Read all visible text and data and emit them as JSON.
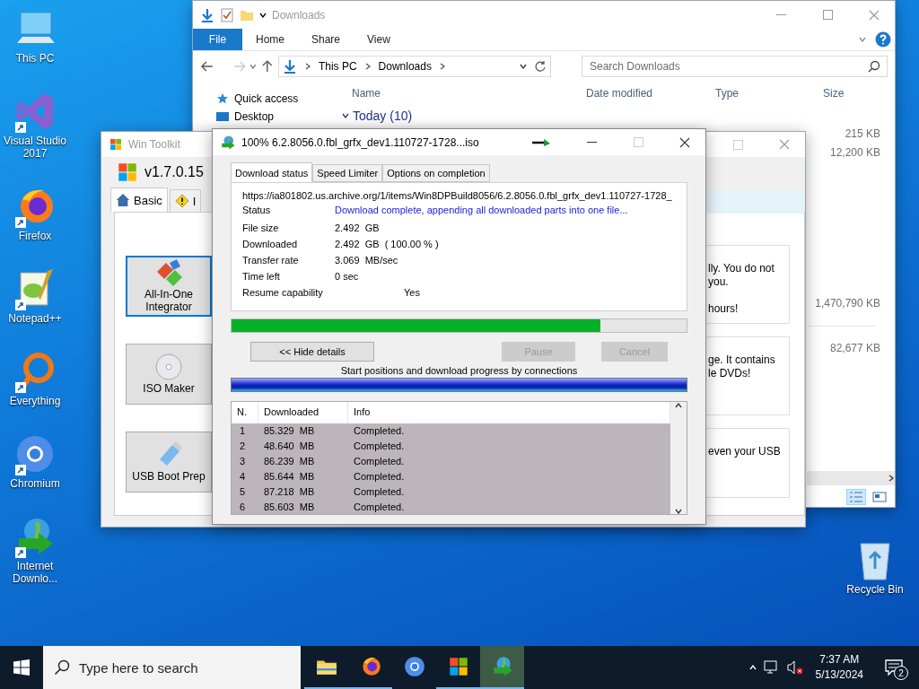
{
  "desktop_icons": [
    {
      "label": "This PC",
      "kind": "pc"
    },
    {
      "label": "Visual Studio 2017",
      "kind": "vs"
    },
    {
      "label": "Firefox",
      "kind": "firefox"
    },
    {
      "label": "Notepad++",
      "kind": "notepad"
    },
    {
      "label": "Everything",
      "kind": "everything"
    },
    {
      "label": "Chromium",
      "kind": "chromium"
    },
    {
      "label": "Internet Downlo...",
      "kind": "idm"
    }
  ],
  "recycle_bin": {
    "label": "Recycle Bin"
  },
  "explorer": {
    "title": "Downloads",
    "ribbon_tabs": [
      {
        "label": "File",
        "selected": true
      },
      {
        "label": "Home",
        "selected": false
      },
      {
        "label": "Share",
        "selected": false
      },
      {
        "label": "View",
        "selected": false
      }
    ],
    "address": [
      "This PC",
      "Downloads"
    ],
    "search": {
      "placeholder": "Search Downloads"
    },
    "nav": [
      "Quick access",
      "Desktop"
    ],
    "columns": [
      "Name",
      "Date modified",
      "Type",
      "Size"
    ],
    "group": "Today (10)",
    "sizes": [
      "215 KB",
      "12,200 KB",
      "1,470,790 KB",
      "82,677 KB"
    ]
  },
  "win_toolkit": {
    "title": "Win Toolkit",
    "version": "v1.7.0.15",
    "tabs": [
      {
        "label": "Basic",
        "selected": true,
        "kind": "home"
      },
      {
        "label": "I",
        "selected": false,
        "kind": "warning"
      }
    ],
    "tools": [
      {
        "label": "All-In-One Integrator",
        "selected": true,
        "kind": "integrator"
      },
      {
        "label": "ISO Maker",
        "selected": false,
        "kind": "disc"
      },
      {
        "label": "USB Boot Prep",
        "selected": false,
        "kind": "usb"
      }
    ],
    "cards": [
      {
        "lines": [
          {
            "text": "lly. You do not"
          },
          {
            "text": "you."
          },
          {
            "text": "hours!"
          }
        ]
      },
      {
        "lines": [
          {
            "text": "ge. It contains"
          },
          {
            "text": "le DVDs!"
          }
        ]
      },
      {
        "lines": [
          {
            "text": "even your USB"
          }
        ]
      }
    ]
  },
  "download_dialog": {
    "title": "100% 6.2.8056.0.fbl_grfx_dev1.110727-1728...iso",
    "tabs": [
      {
        "label": "Download status",
        "selected": true
      },
      {
        "label": "Speed Limiter",
        "selected": false
      },
      {
        "label": "Options on completion",
        "selected": false
      }
    ],
    "url": "https://ia801802.us.archive.org/1/items/Win8DPBuild8056/6.2.8056.0.fbl_grfx_dev1.110727-1728_",
    "status_label": "Status",
    "status": "Download complete, appending all downloaded parts into one file...",
    "fields": [
      {
        "label": "File size",
        "value": "2.492  GB"
      },
      {
        "label": "Downloaded",
        "value": "2.492  GB  ( 100.00 % )"
      },
      {
        "label": "Transfer rate",
        "value": "3.069  MB/sec"
      },
      {
        "label": "Time left",
        "value": "0 sec"
      },
      {
        "label": "Resume capability",
        "value": "Yes",
        "kind": "wide"
      }
    ],
    "progress": {
      "level": 0.81
    },
    "buttons": [
      {
        "label": "<< Hide details",
        "disabled": false
      },
      {
        "label": "Pause",
        "disabled": true
      },
      {
        "label": "Cancel",
        "disabled": true
      }
    ],
    "connections_caption": "Start positions and download progress by connections",
    "connections_progress": {
      "level": 1
    },
    "table": {
      "columns": [
        "N.",
        "Downloaded",
        "Info"
      ],
      "rows": [
        [
          "1",
          "85.329  MB",
          "Completed."
        ],
        [
          "2",
          "48.640  MB",
          "Completed."
        ],
        [
          "3",
          "86.239  MB",
          "Completed."
        ],
        [
          "4",
          "85.644  MB",
          "Completed."
        ],
        [
          "5",
          "87.218  MB",
          "Completed."
        ],
        [
          "6",
          "85.603  MB",
          "Completed."
        ]
      ]
    }
  },
  "taskbar": {
    "search": {
      "placeholder": "Type here to search"
    },
    "apps": [
      {
        "kind": "folder",
        "running": true,
        "active": false
      },
      {
        "kind": "firefox",
        "running": true,
        "active": false
      },
      {
        "kind": "chromium",
        "running": false,
        "active": false
      },
      {
        "kind": "wintoolkit",
        "running": true,
        "active": false
      },
      {
        "kind": "idm",
        "running": true,
        "active": true
      }
    ],
    "time": "7:37 AM",
    "date": "5/13/2024",
    "notification_count": "2"
  }
}
